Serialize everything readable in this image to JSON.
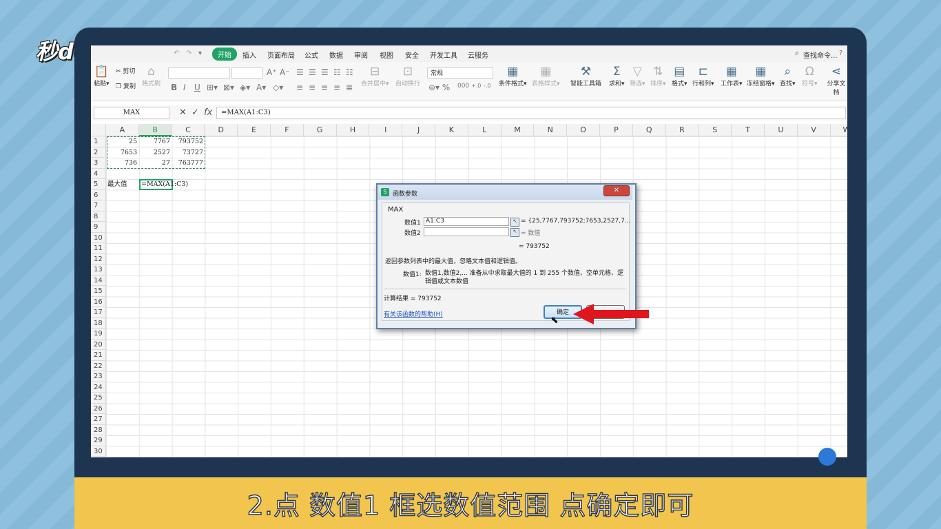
{
  "logo_text": "秒dong视频",
  "caption": "2.点 数值1 框选数值范围 点确定即可",
  "menubar": {
    "items": [
      "开始",
      "插入",
      "页面布局",
      "公式",
      "数据",
      "审阅",
      "视图",
      "安全",
      "开发工具",
      "云服务"
    ],
    "active": "开始",
    "search": "查找命令..."
  },
  "toolbar": {
    "paste": "粘贴",
    "cut": "剪切",
    "copy": "复制",
    "format_painter": "格式刷",
    "bold": "B",
    "italic": "I",
    "underline": "U",
    "font_grow": "A⁺",
    "font_shrink": "A⁻",
    "merge_center": "合并居中",
    "wrap_text": "自动换行",
    "number_format": "常规",
    "cond_format": "条件格式",
    "table_style": "表格样式",
    "smart_toolbox": "智能工具箱",
    "sum": "求和",
    "filter": "筛选",
    "sort": "排序",
    "format": "格式",
    "row_col": "行和列",
    "worksheet": "工作表",
    "freeze": "冻结窗格",
    "find": "查找",
    "symbol": "符号",
    "share": "分享文档"
  },
  "formula_bar": {
    "name_box": "MAX",
    "cancel": "✕",
    "enter": "✓",
    "fx": "fx",
    "formula": "=MAX(A1:C3)"
  },
  "sheet": {
    "columns": [
      "A",
      "B",
      "C",
      "D",
      "E",
      "F",
      "G",
      "H",
      "I",
      "J",
      "K",
      "L",
      "M",
      "N",
      "O",
      "P",
      "Q",
      "R",
      "S",
      "T",
      "U",
      "V",
      "W"
    ],
    "selected_column": "B",
    "rows": [
      "1",
      "2",
      "3",
      "4",
      "5",
      "6",
      "7",
      "8",
      "9",
      "10",
      "11",
      "12",
      "13",
      "14",
      "15",
      "16",
      "17",
      "18",
      "19",
      "20",
      "21",
      "22",
      "23",
      "24",
      "25",
      "26",
      "27",
      "28",
      "29",
      "30"
    ],
    "data": [
      [
        "25",
        "7767",
        "793752"
      ],
      [
        "7653",
        "2527",
        "73727"
      ],
      [
        "736",
        "27",
        "763777"
      ]
    ],
    "label_a5": "最大值",
    "b5_formula": "=MAX(A1:C3)"
  },
  "dialog": {
    "title": "函数参数",
    "func_name": "MAX",
    "arg1_label": "数值1",
    "arg1_value": "A1:C3",
    "arg1_result": "= {25,7767,793752;7653,2527,7...",
    "arg2_label": "数值2",
    "arg2_result": "= 数值",
    "result_preview": "= 793752",
    "description": "返回参数列表中的最大值，忽略文本值和逻辑值。",
    "param_name": "数值1:",
    "param_desc": "数值1,数值2,... 准备从中求取最大值的 1 到 255 个数值、空单元格、逻辑值或文本数值",
    "calc_result": "计算结果 = 793752",
    "help_link": "有关该函数的帮助(H)",
    "ok": "确定",
    "close": "✕"
  },
  "colors": {
    "accent": "#21a366",
    "caption_bg": "#f1c54e",
    "arrow": "#e0161e",
    "monitor": "#1e3552"
  }
}
